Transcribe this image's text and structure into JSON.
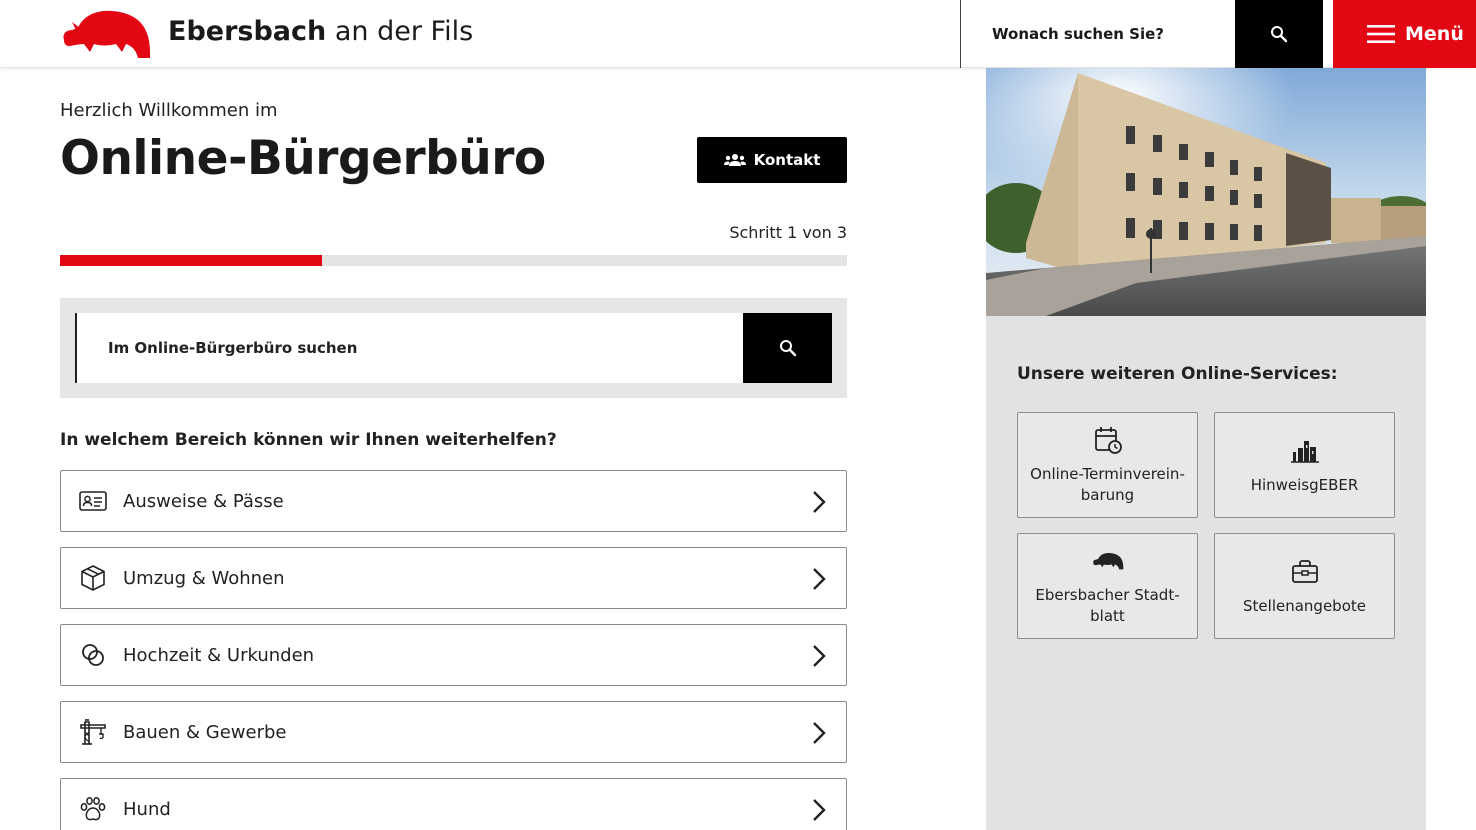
{
  "header": {
    "site_name_bold": "Ebersbach",
    "site_name_rest": " an der Fils",
    "search_placeholder": "Wonach suchen Sie?",
    "menu_label": "Menü"
  },
  "main": {
    "welcome": "Herzlich Willkommen im",
    "title": "Online-Bürgerbüro",
    "contact_label": "Kontakt",
    "step_text": "Schritt 1 von 3",
    "progress_fraction": 0.3333,
    "search_placeholder": "Im Online-Bürgerbüro suchen",
    "question": "In welchem Bereich können wir Ihnen weiterhelfen?",
    "categories": [
      {
        "label": "Ausweise & Pässe",
        "icon": "id-card-icon"
      },
      {
        "label": "Umzug & Wohnen",
        "icon": "box-icon"
      },
      {
        "label": "Hochzeit & Urkunden",
        "icon": "rings-icon"
      },
      {
        "label": "Bauen & Gewerbe",
        "icon": "crane-icon"
      },
      {
        "label": "Hund",
        "icon": "paw-icon"
      }
    ]
  },
  "sidebar": {
    "services_title": "Unsere weiteren Online-Services:",
    "services": [
      {
        "label": "Online-Terminverein-\nbarung",
        "icon": "calendar-clock-icon"
      },
      {
        "label": "HinweisgEBER",
        "icon": "building-icon"
      },
      {
        "label": "Ebersbacher Stadt-\nblatt",
        "icon": "boar-icon"
      },
      {
        "label": "Stellenangebote",
        "icon": "briefcase-icon"
      }
    ]
  },
  "colors": {
    "brand_red": "#e30613",
    "black": "#000000",
    "panel_gray": "#e2e2e2"
  }
}
